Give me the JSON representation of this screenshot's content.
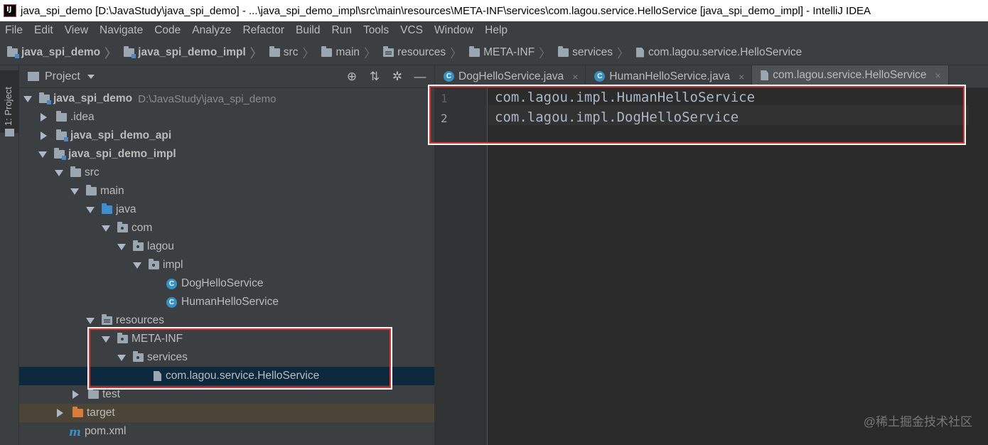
{
  "window": {
    "title": "java_spi_demo [D:\\JavaStudy\\java_spi_demo] - ...\\java_spi_demo_impl\\src\\main\\resources\\META-INF\\services\\com.lagou.service.HelloService [java_spi_demo_impl] - IntelliJ IDEA",
    "app_icon_text": "IJ"
  },
  "menu": [
    "File",
    "Edit",
    "View",
    "Navigate",
    "Code",
    "Analyze",
    "Refactor",
    "Build",
    "Run",
    "Tools",
    "VCS",
    "Window",
    "Help"
  ],
  "breadcrumbs": [
    {
      "label": "java_spi_demo",
      "icon": "module-folder-icon"
    },
    {
      "label": "java_spi_demo_impl",
      "icon": "module-folder-icon"
    },
    {
      "label": "src",
      "icon": "folder-icon"
    },
    {
      "label": "main",
      "icon": "folder-icon"
    },
    {
      "label": "resources",
      "icon": "resources-folder-icon"
    },
    {
      "label": "META-INF",
      "icon": "folder-icon"
    },
    {
      "label": "services",
      "icon": "folder-icon"
    },
    {
      "label": "com.lagou.service.HelloService",
      "icon": "file-icon"
    }
  ],
  "side_strip": {
    "tab_label": "1: Project"
  },
  "project_panel": {
    "title": "Project",
    "tools": [
      "locate-icon",
      "collapse-icon",
      "gear-icon",
      "hide-icon"
    ],
    "tree": [
      {
        "label": "java_spi_demo",
        "path": "D:\\JavaStudy\\java_spi_demo",
        "expanded": true,
        "icon": "module-folder-icon"
      },
      {
        "label": ".idea",
        "expanded": false,
        "icon": "folder-icon"
      },
      {
        "label": "java_spi_demo_api",
        "expanded": false,
        "icon": "module-folder-icon"
      },
      {
        "label": "java_spi_demo_impl",
        "expanded": true,
        "icon": "module-folder-icon"
      },
      {
        "label": "src",
        "expanded": true,
        "icon": "folder-icon"
      },
      {
        "label": "main",
        "expanded": true,
        "icon": "folder-icon"
      },
      {
        "label": "java",
        "expanded": true,
        "icon": "source-folder-icon"
      },
      {
        "label": "com",
        "expanded": true,
        "icon": "package-icon"
      },
      {
        "label": "lagou",
        "expanded": true,
        "icon": "package-icon"
      },
      {
        "label": "impl",
        "expanded": true,
        "icon": "package-icon"
      },
      {
        "label": "DogHelloService",
        "icon": "class-icon"
      },
      {
        "label": "HumanHelloService",
        "icon": "class-icon"
      },
      {
        "label": "resources",
        "expanded": true,
        "icon": "resources-folder-icon"
      },
      {
        "label": "META-INF",
        "expanded": true,
        "icon": "package-icon"
      },
      {
        "label": "services",
        "expanded": true,
        "icon": "package-icon"
      },
      {
        "label": "com.lagou.service.HelloService",
        "icon": "file-icon",
        "selected": true
      },
      {
        "label": "test",
        "expanded": false,
        "icon": "folder-icon"
      },
      {
        "label": "target",
        "expanded": false,
        "icon": "excluded-folder-icon"
      },
      {
        "label": "pom.xml",
        "icon": "maven-icon"
      }
    ]
  },
  "editor": {
    "tabs": [
      {
        "label": "DogHelloService.java",
        "icon": "class-icon",
        "active": false
      },
      {
        "label": "HumanHelloService.java",
        "icon": "class-icon",
        "active": false
      },
      {
        "label": "com.lagou.service.HelloService",
        "icon": "file-icon",
        "active": true
      }
    ],
    "close_glyph": "×",
    "lines": [
      {
        "num": "1",
        "text": "com.lagou.impl.HumanHelloService"
      },
      {
        "num": "2",
        "text": "com.lagou.impl.DogHelloService"
      }
    ]
  },
  "watermark": "@稀土掘金技术社区",
  "colors": {
    "highlight_box": "#e0332d",
    "selection": "#0d293e",
    "accent": "#4a88c7"
  }
}
